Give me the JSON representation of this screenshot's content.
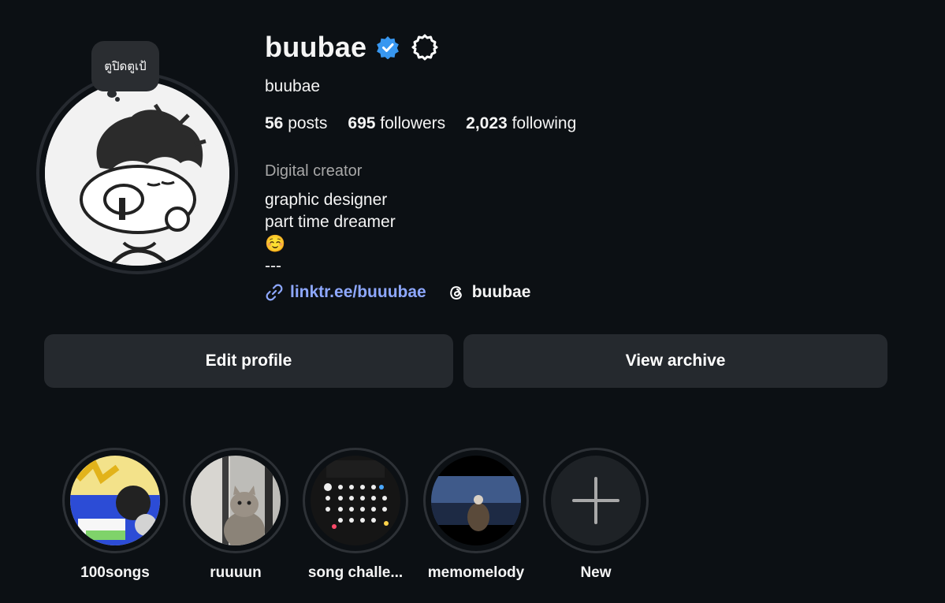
{
  "profile": {
    "note": "ตูปิดตูเป้",
    "username": "buubae",
    "full_name": "buubae",
    "stats": {
      "posts_count": "56",
      "posts_label": "posts",
      "followers_count": "695",
      "followers_label": "followers",
      "following_count": "2,023",
      "following_label": "following"
    },
    "category": "Digital creator",
    "bio_lines": [
      "graphic designer",
      "part time dreamer",
      "☺️",
      "---"
    ],
    "link_text": "linktr.ee/buuubae",
    "threads_handle": "buubae"
  },
  "actions": {
    "edit_label": "Edit profile",
    "archive_label": "View archive"
  },
  "highlights": [
    {
      "label": "100songs"
    },
    {
      "label": "ruuuun"
    },
    {
      "label": "song challe..."
    },
    {
      "label": "memomelody"
    },
    {
      "label": "New"
    }
  ],
  "colors": {
    "background": "#0c1014",
    "button": "#25292e",
    "link": "#8ea8ff",
    "verified": "#3897f0",
    "muted": "#a8a8a8"
  }
}
